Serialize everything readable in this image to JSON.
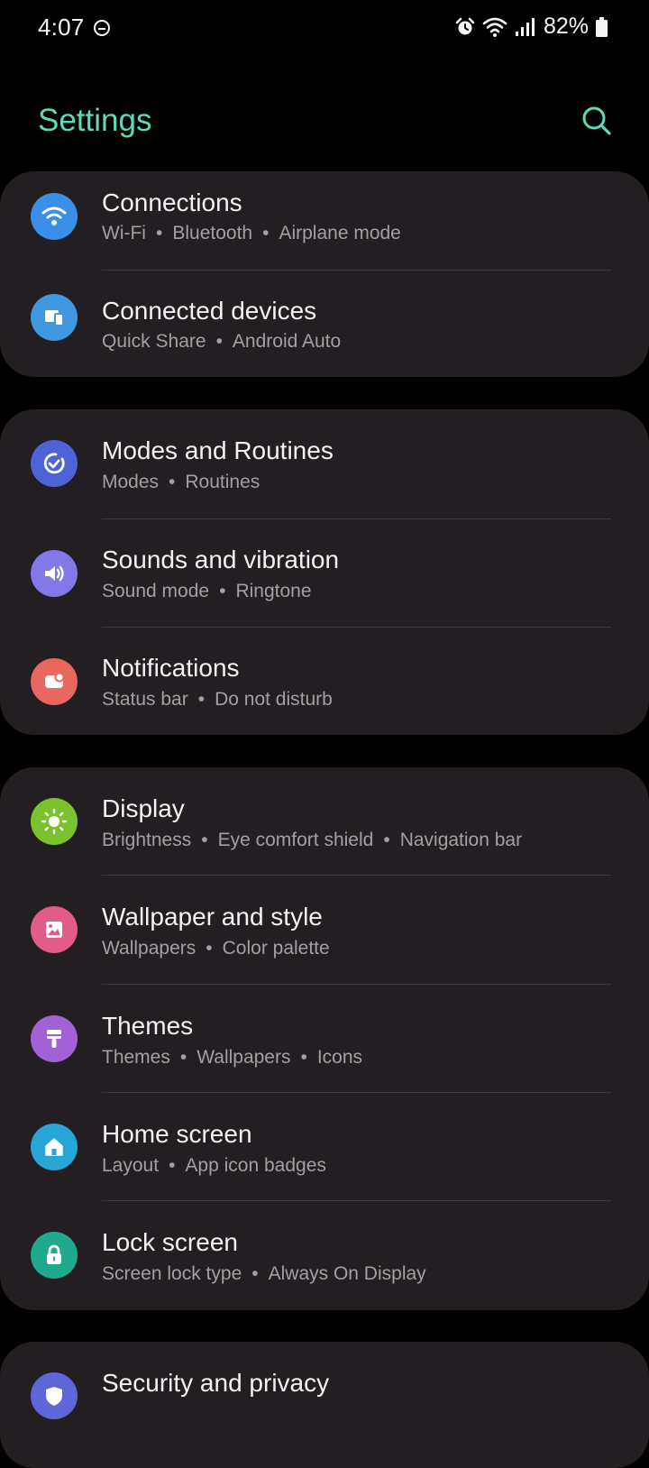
{
  "status_bar": {
    "time": "4:07",
    "battery": "82%",
    "icons": [
      "do-not-disturb-icon",
      "alarm-icon",
      "wifi-icon",
      "signal-icon",
      "battery-icon"
    ]
  },
  "header": {
    "title": "Settings",
    "search_icon": "search-icon",
    "accent": "#5fd9b8"
  },
  "groups": [
    {
      "items": [
        {
          "title": "Connections",
          "subtitle": [
            "Wi-Fi",
            "Bluetooth",
            "Airplane mode"
          ],
          "icon": "wifi-icon",
          "color": "#3a8fe8"
        },
        {
          "title": "Connected devices",
          "subtitle": [
            "Quick Share",
            "Android Auto"
          ],
          "icon": "devices-icon",
          "color": "#3e97df"
        }
      ]
    },
    {
      "items": [
        {
          "title": "Modes and Routines",
          "subtitle": [
            "Modes",
            "Routines"
          ],
          "icon": "routine-check-icon",
          "color": "#4d63d6"
        },
        {
          "title": "Sounds and vibration",
          "subtitle": [
            "Sound mode",
            "Ringtone"
          ],
          "icon": "speaker-icon",
          "color": "#8378e8"
        },
        {
          "title": "Notifications",
          "subtitle": [
            "Status bar",
            "Do not disturb"
          ],
          "icon": "notification-icon",
          "color": "#e8675e"
        }
      ]
    },
    {
      "items": [
        {
          "title": "Display",
          "subtitle": [
            "Brightness",
            "Eye comfort shield",
            "Navigation bar"
          ],
          "icon": "sun-icon",
          "color": "#7cc22e"
        },
        {
          "title": "Wallpaper and style",
          "subtitle": [
            "Wallpapers",
            "Color palette"
          ],
          "icon": "image-icon",
          "color": "#e15c86"
        },
        {
          "title": "Themes",
          "subtitle": [
            "Themes",
            "Wallpapers",
            "Icons"
          ],
          "icon": "paintbrush-icon",
          "color": "#a262d6"
        },
        {
          "title": "Home screen",
          "subtitle": [
            "Layout",
            "App icon badges"
          ],
          "icon": "home-icon",
          "color": "#27a5d6"
        },
        {
          "title": "Lock screen",
          "subtitle": [
            "Screen lock type",
            "Always On Display"
          ],
          "icon": "lock-icon",
          "color": "#1fa98d"
        }
      ]
    },
    {
      "items": [
        {
          "title": "Security and privacy",
          "subtitle": [],
          "icon": "shield-icon",
          "color": "#5f67d8"
        }
      ]
    }
  ]
}
